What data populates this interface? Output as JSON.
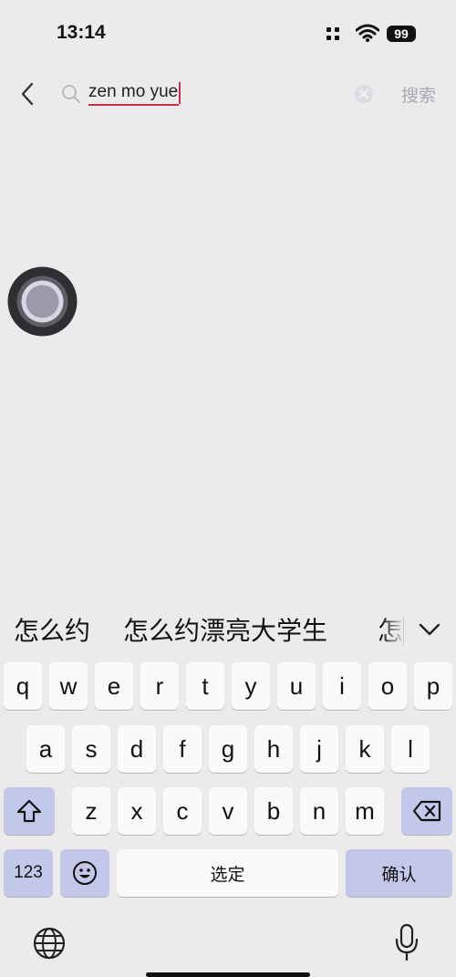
{
  "status_bar": {
    "time": "13:14",
    "battery": "99"
  },
  "search": {
    "query": "zen mo yue",
    "button_label": "搜索"
  },
  "candidates": [
    "怎么约",
    "怎么约漂亮大学生",
    "怎"
  ],
  "keyboard": {
    "row1": [
      "q",
      "w",
      "e",
      "r",
      "t",
      "y",
      "u",
      "i",
      "o",
      "p"
    ],
    "row2": [
      "a",
      "s",
      "d",
      "f",
      "g",
      "h",
      "j",
      "k",
      "l"
    ],
    "row3": [
      "z",
      "x",
      "c",
      "v",
      "b",
      "n",
      "m"
    ],
    "numbers_label": "123",
    "space_label": "选定",
    "confirm_label": "确认"
  },
  "colors": {
    "accent": "#c8304a",
    "function_key": "#c3c8ea",
    "background": "#ebebeb"
  }
}
